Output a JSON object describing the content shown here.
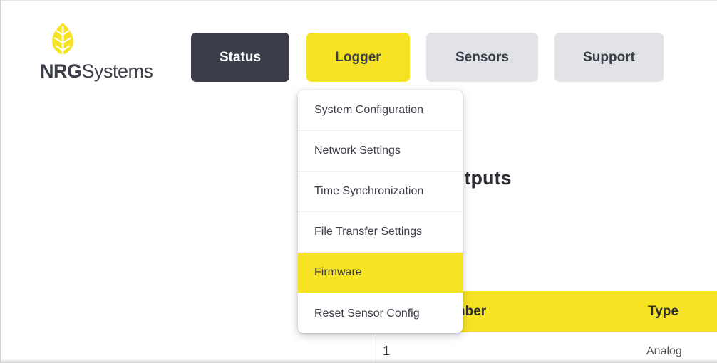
{
  "logo": {
    "text_bold": "NRG",
    "text_regular": "Systems",
    "icon": "leaf-icon",
    "color": "#f6e324"
  },
  "nav": {
    "status": "Status",
    "logger": "Logger",
    "sensors": "Sensors",
    "support": "Support"
  },
  "logger_menu": {
    "items": [
      "System Configuration",
      "Network Settings",
      "Time Synchronization",
      "File Transfer Settings",
      "Firmware",
      "Reset Sensor Config"
    ],
    "active": "Firmware"
  },
  "main": {
    "heading_partial": "utputs",
    "table": {
      "headers": [
        "nber",
        "Type"
      ],
      "rows": [
        [
          "1",
          "Analog"
        ]
      ]
    }
  },
  "colors": {
    "brand_yellow": "#f6e324",
    "dark": "#3b3d48",
    "light_gray": "#e1e3e6"
  }
}
